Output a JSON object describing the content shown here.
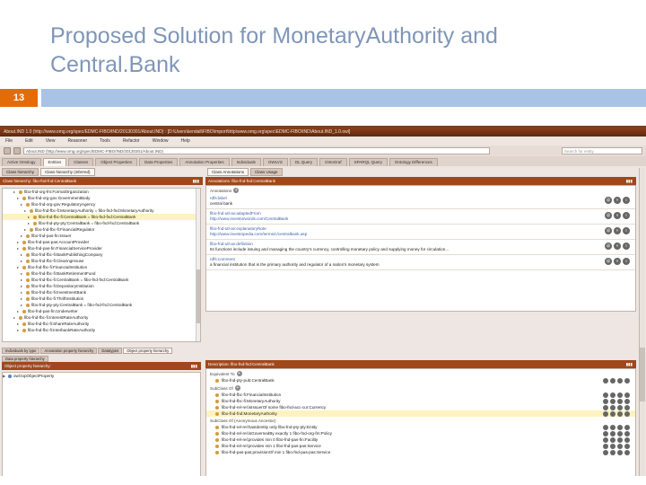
{
  "slide": {
    "title": "Proposed Solution for MonetaryAuthority and Central.Bank",
    "number": "13"
  },
  "app": {
    "window_title": "About.IND 1.0 (http://www.omg.org/spec/EDMC-FIBO/IND/20130301/About.IND) : [D:\\Users\\kendall\\FIBO\\import\\http\\www.omg.org\\spec\\EDMC-FIBO\\IND\\About.IND_1.0.owl]",
    "menu": [
      "File",
      "Edit",
      "View",
      "Reasoner",
      "Tools",
      "Refactor",
      "Window",
      "Help"
    ],
    "address": "About.IND (http://www.omg.org/spec/EDMC-FIBO/IND/20130301/About.IND)",
    "search_placeholder": "Search for entity",
    "tabs": [
      "Active Ontology",
      "Entities",
      "Classes",
      "Object Properties",
      "Data Properties",
      "Annotation Properties",
      "Individuals",
      "OWLViz",
      "DL Query",
      "OntoGraf",
      "SPARQL Query",
      "Ontology Differences"
    ],
    "active_tab": 1
  },
  "left": {
    "subtabs": [
      "Class hierarchy",
      "Class hierarchy (inferred)"
    ],
    "panel_title": "Class hierarchy: fibo-fnd-fnd:CentralBank",
    "tree": [
      {
        "indent": 3,
        "label": "fibo-fnd-org-fm:FormalOrganization"
      },
      {
        "indent": 4,
        "label": "fibo-fnd-org-gov:GovernmentBody"
      },
      {
        "indent": 5,
        "label": "fibo-fnd-org-gov:RegulatoryAgency"
      },
      {
        "indent": 6,
        "label": "fibo-fnd-fbc-fi:MonetaryAuthority = fibo-fnd-fnd:MonetaryAuthority"
      },
      {
        "indent": 7,
        "label": "fibo-fnd-fbc-fi:CentralBank = fibo-fnd-fnd:CentralBank",
        "highlight": true
      },
      {
        "indent": 7,
        "label": "fibo-fnd-pty-pty:CentralBank = fibo-fnd-fnd:CentralBank"
      },
      {
        "indent": 6,
        "label": "fibo-fnd-fbc-fi:FinancialRegulator"
      },
      {
        "indent": 5,
        "label": "fibo-fnd-pas-fin:Issuer"
      },
      {
        "indent": 4,
        "label": "fibo-fnd-pas-pas:AccountProvider"
      },
      {
        "indent": 4,
        "label": "fibo-fnd-pas-fin:FinancialServiceProvider"
      },
      {
        "indent": 5,
        "label": "fibo-fnd-fbc-fi:BankPublishingCompany"
      },
      {
        "indent": 5,
        "label": "fibo-fnd-fbc-fi:ClearingHouse"
      },
      {
        "indent": 4,
        "label": "fibo-fnd-fbc-fi:FinancialInstitution"
      },
      {
        "indent": 5,
        "label": "fibo-fnd-fbc-fi:BankRetirementFund"
      },
      {
        "indent": 5,
        "label": "fibo-fnd-fbc-fi:CentralBank = fibo-fnd-fnd:CentralBank"
      },
      {
        "indent": 5,
        "label": "fibo-fnd-fbc-fi:DepositoryInstitution"
      },
      {
        "indent": 5,
        "label": "fibo-fnd-fbc-fi:InvestmentBank"
      },
      {
        "indent": 5,
        "label": "fibo-fnd-fbc-fi:ThriftInstitution"
      },
      {
        "indent": 5,
        "label": "fibo-fnd-pty-pty:CentralBank = fibo-fnd-fnd:CentralBank"
      },
      {
        "indent": 4,
        "label": "fibo-fnd-pas-fin:Underwriter"
      },
      {
        "indent": 3,
        "label": "fibo-fnd-fbc-fi:InterestRateAuthority"
      },
      {
        "indent": 4,
        "label": "fibo-fnd-fbc-fi:ShareRateAuthority"
      },
      {
        "indent": 4,
        "label": "fibo-fnd-fbc-fi:InterbankRateAuthority"
      }
    ],
    "lower_tabs": [
      "Individuals by type",
      "Annotation property hierarchy",
      "Datatypes",
      "Object property hierarchy",
      "Data property hierarchy"
    ],
    "lower_panel_title": "Object property hierarchy:",
    "lower_item": "owl:topObjectProperty"
  },
  "annotations": {
    "subtabs": [
      "Class Annotations",
      "Class Usage"
    ],
    "panel_title": "Annotations: fibo-fnd-fnd:CentralBank",
    "header": "Annotations",
    "items": [
      {
        "prop": "rdfs:label",
        "value": "central bank",
        "link": false
      },
      {
        "prop": "fibo-fnd-utl-av:adaptedFrom",
        "value": "http://www.investorwords.com/CentralBank",
        "link": true
      },
      {
        "prop": "fibo-fnd-utl-av:explanatoryNote",
        "value": "http://www.investopedia.com/terms/c/centralbank.asp",
        "link": true
      },
      {
        "prop": "fibo-fnd-utl-av:definition",
        "value": "Its functions include issuing and managing the country's currency, controlling monetary policy and supplying money for circulation...",
        "link": false
      },
      {
        "prop": "rdfs:comment",
        "value": "a financial institution that is the primary authority and regulator of a nation's monetary system",
        "link": false
      }
    ]
  },
  "description": {
    "panel_title": "Description: fibo-fnd-fnd:CentralBank",
    "equivalent_label": "Equivalent To",
    "equivalent": [
      "fibo-fnd-pty-pub:CentralBank"
    ],
    "subclass_label": "SubClass Of",
    "subclasses": [
      {
        "text": "fibo-fnd-fbc-fi:FinancialInstitution",
        "hl": false
      },
      {
        "text": "fibo-fnd-fbc-fi:MonetaryAuthority",
        "hl": false
      },
      {
        "text": "fibo-fnd-rel-rel:isIssuerOf some fibo-fnd-acc-cur:Currency",
        "hl": false
      },
      {
        "text": "fibo-fnd-fnd:MonetaryAuthority",
        "hl": true
      }
    ],
    "anon_label": "SubClass Of (Anonymous Ancestor)",
    "anon": [
      "fibo-fnd-rel-rel:hasIdentity only fibo-fnd-pty-pty:Entity",
      "fibo-fnd-rel-rel:isGovernedBy exactly 1 fibo-fnd-org-fm:Policy",
      "fibo-fnd-rel-rel:provides min 0 fibo-fnd-pas-fin:Facility",
      "fibo-fnd-rel-rel:provides min 1 fibo-fnd-pas-pas:Service",
      "fibo-fnd-pas-pas:provisionOf min 1 fibo-fnd-pas-pas:Service"
    ]
  }
}
